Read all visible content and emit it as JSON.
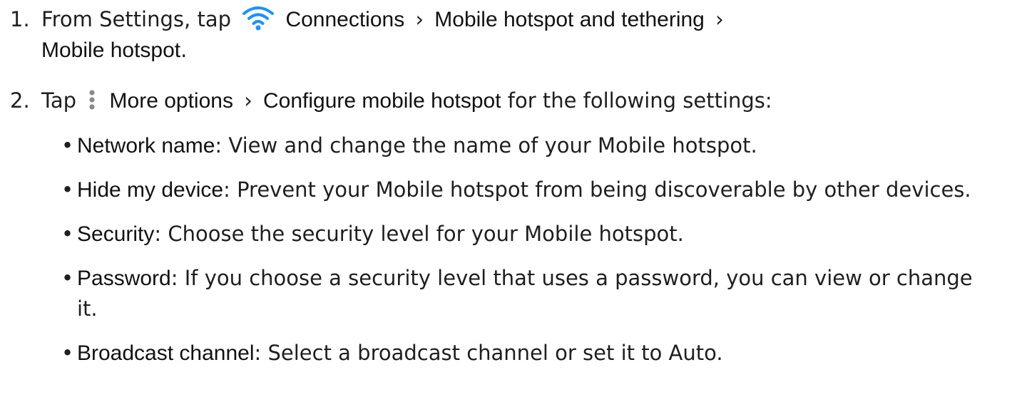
{
  "colors": {
    "text": "#1f1f1f",
    "wifi_icon": "#1e90ff",
    "more_icon": "#8a8a8a"
  },
  "step1": {
    "number": "1.",
    "prefix": "From Settings, tap",
    "icon": "wifi-icon",
    "connections": "Connections",
    "separator1": "›",
    "hotspot_tethering": "Mobile hotspot and tethering",
    "separator2": "›",
    "mobile_hotspot": "Mobile hotspot",
    "suffix": "."
  },
  "step2": {
    "number": "2.",
    "prefix": "Tap",
    "icon": "more-options-icon",
    "more_options": "More options",
    "separator": "›",
    "configure": "Configure mobile hotspot",
    "suffix": "for the following settings:"
  },
  "bullets": [
    {
      "term": "Network name",
      "description": ": View and change the name of your Mobile hotspot."
    },
    {
      "term": "Hide my device",
      "description": ": Prevent your Mobile hotspot from being discoverable by other devices."
    },
    {
      "term": "Security",
      "description": ": Choose the security level for your Mobile hotspot."
    },
    {
      "term": "Password",
      "description": ": If you choose a security level that uses a password, you can view or change it."
    },
    {
      "term": "Broadcast channel",
      "description": ": Select a broadcast channel or set it to Auto."
    }
  ],
  "bullet_symbol": "•"
}
